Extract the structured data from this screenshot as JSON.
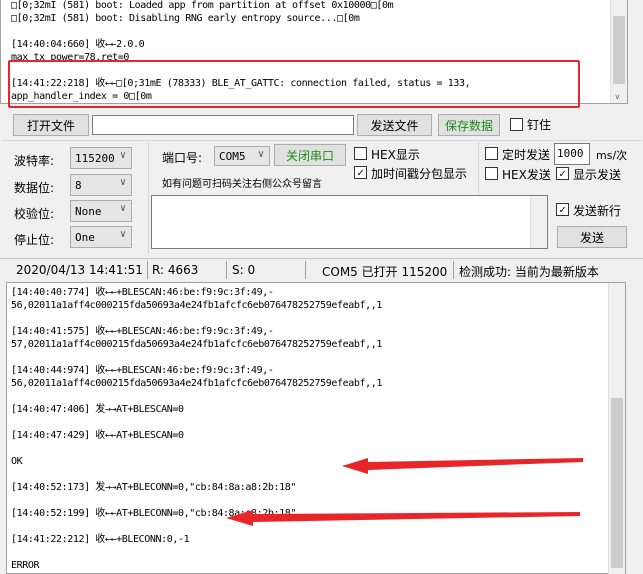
{
  "top_log": {
    "lines": [
      "□[0;32mI (581) boot: Loaded app from partition at offset 0x10000□[0m",
      "□[0;32mI (581) boot: Disabling RNG early entropy source...□[0m",
      "",
      "[14:40:04:660] 收←←2.0.0",
      "max tx power=78,ret=0",
      "",
      "[14:41:22:218] 收←←□[0;31mE (78333) BLE_AT_GATTC: connection failed, status = 133,",
      "app_handler_index = 0□[0m"
    ]
  },
  "toolbar": {
    "open_file": "打开文件",
    "file_path": "",
    "send_file": "发送文件",
    "save_data": "保存数据",
    "pin": "钉住",
    "pin_checked": false
  },
  "serial": {
    "baud_label": "波特率:",
    "baud": "115200",
    "data_bits_label": "数据位:",
    "data_bits": "8",
    "parity_label": "校验位:",
    "parity": "None",
    "stop_bits_label": "停止位:",
    "stop_bits": "One"
  },
  "port": {
    "label": "端口号:",
    "value": "COM5",
    "close_button": "关闭串口",
    "hint": "如有问题可扫码关注右侧公众号留言"
  },
  "display": {
    "hex_display": "HEX显示",
    "hex_display_checked": false,
    "timestamp": "加时间戳分包显示",
    "timestamp_checked": true
  },
  "send_opts": {
    "timed_send": "定时发送",
    "timed_checked": false,
    "interval": "1000",
    "unit": "ms/次",
    "hex_send": "HEX发送",
    "hex_send_checked": false,
    "show_send": "显示发送",
    "show_send_checked": true,
    "send_newline": "发送新行",
    "send_newline_checked": true,
    "send_button": "发送",
    "send_text": ""
  },
  "status": {
    "datetime": "2020/04/13 14:41:51",
    "rx": "R: 4663",
    "tx": "S: 0",
    "port_state": "COM5 已打开 115200",
    "update": "检测成功: 当前为最新版本"
  },
  "bottom_log": {
    "lines": [
      "[14:40:40:774] 收←←+BLESCAN:46:be:f9:9c:3f:49,-",
      "56,02011a1aff4c000215fda50693a4e24fb1afcfc6eb076478252759efeabf,,1",
      "",
      "[14:40:41:575] 收←←+BLESCAN:46:be:f9:9c:3f:49,-",
      "57,02011a1aff4c000215fda50693a4e24fb1afcfc6eb076478252759efeabf,,1",
      "",
      "[14:40:44:974] 收←←+BLESCAN:46:be:f9:9c:3f:49,-",
      "56,02011a1aff4c000215fda50693a4e24fb1afcfc6eb076478252759efeabf,,1",
      "",
      "[14:40:47:406] 发→→AT+BLESCAN=0",
      "",
      "[14:40:47:429] 收←←AT+BLESCAN=0",
      "",
      "OK",
      "",
      "[14:40:52:173] 发→→AT+BLECONN=0,\"cb:84:8a:a8:2b:18\"",
      "",
      "[14:40:52:199] 收←←AT+BLECONN=0,\"cb:84:8a:a8:2b:18\"",
      "",
      "[14:41:22:212] 收←←+BLECONN:0,-1",
      "",
      "ERROR"
    ]
  },
  "colors": {
    "annotation": "#e8262a",
    "green_text": "#1a8a1a"
  }
}
